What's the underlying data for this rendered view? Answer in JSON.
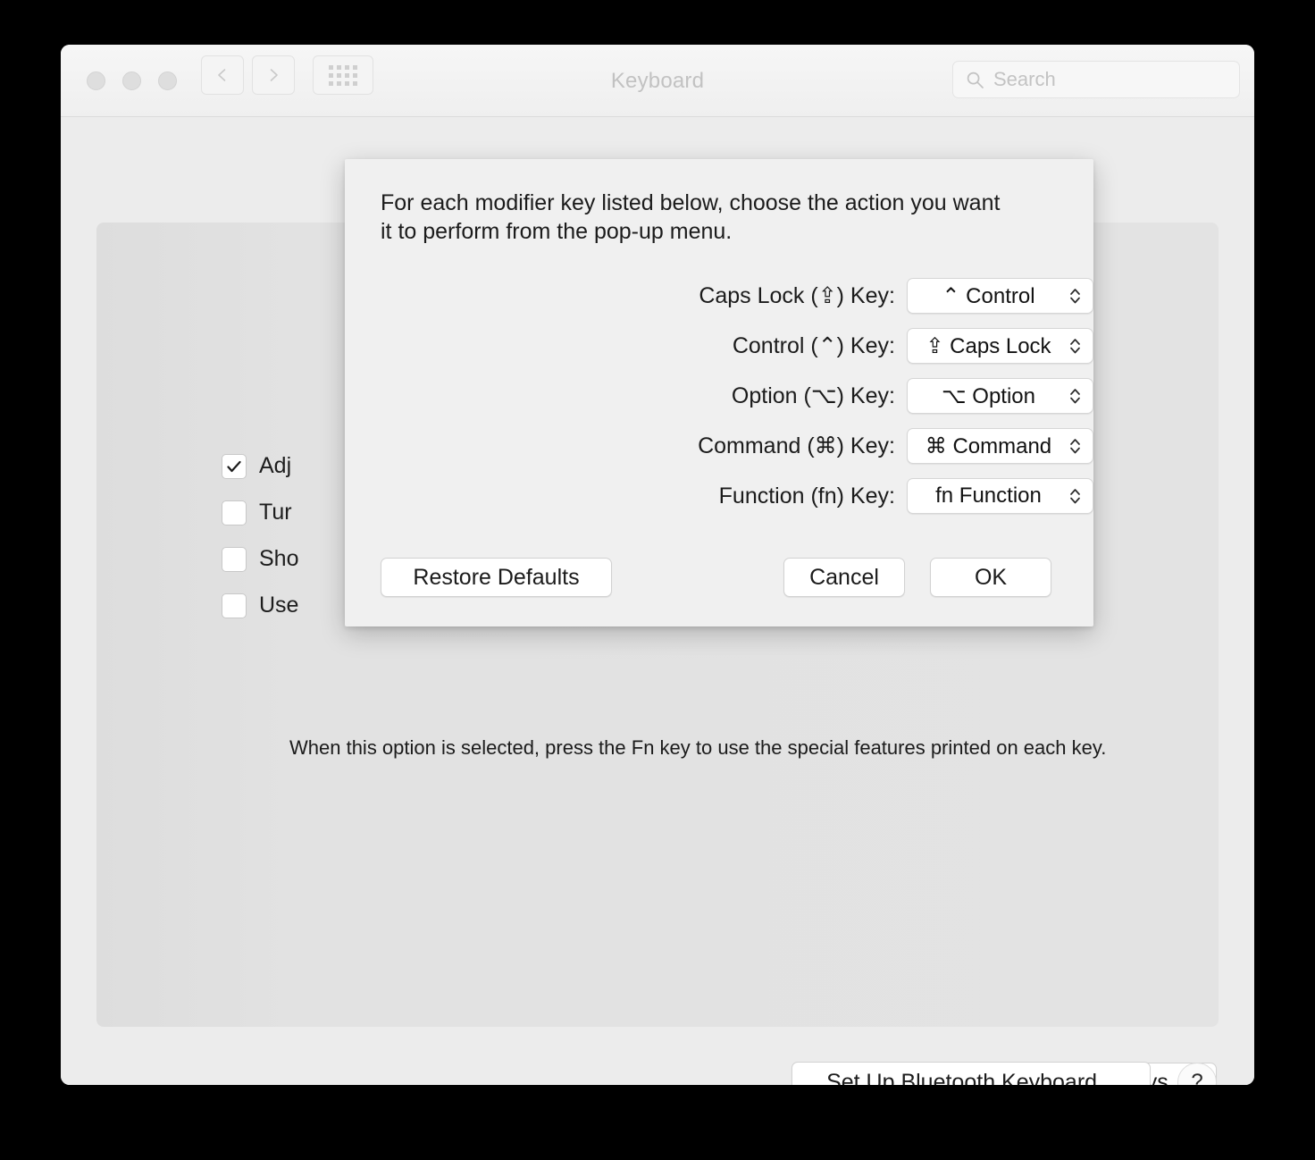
{
  "window": {
    "title": "Keyboard",
    "traffic_lights": [
      "close",
      "minimize",
      "zoom"
    ],
    "toolbar": {
      "back_icon": "chevron-left-icon",
      "forward_icon": "chevron-right-icon",
      "show_all_icon": "grid-icon"
    },
    "search": {
      "icon": "search-icon",
      "placeholder": "Search",
      "value": ""
    }
  },
  "main": {
    "checkboxes": [
      {
        "label": "Adj",
        "checked": true
      },
      {
        "label": "Tur",
        "checked": false
      },
      {
        "label": "Sho",
        "checked": false
      },
      {
        "label": "Use",
        "checked": false
      }
    ],
    "hint": "When this option is selected, press the Fn key to use the special features printed on each key.",
    "modifier_keys_button": "Modifier Keys...",
    "setup_bluetooth_button": "Set Up Bluetooth Keyboard...",
    "help_button": "?"
  },
  "sheet": {
    "description": "For each modifier key listed below, choose the action you want it to perform from the pop-up menu.",
    "rows": [
      {
        "label": "Caps Lock (⇪) Key:",
        "value": "⌃ Control",
        "name": "caps-lock-key"
      },
      {
        "label": "Control (⌃) Key:",
        "value": "⇪ Caps Lock",
        "name": "control-key"
      },
      {
        "label": "Option (⌥) Key:",
        "value": "⌥ Option",
        "name": "option-key"
      },
      {
        "label": "Command (⌘) Key:",
        "value": "⌘ Command",
        "name": "command-key"
      },
      {
        "label": "Function (fn) Key:",
        "value": "fn Function",
        "name": "function-key"
      }
    ],
    "buttons": {
      "restore_defaults": "Restore Defaults",
      "cancel": "Cancel",
      "ok": "OK"
    }
  },
  "colors": {
    "window_bg": "#ececec",
    "panel_bg": "#e2e2e2",
    "sheet_bg": "#f0f0f0",
    "title_text": "#c2c2c2",
    "body_text": "#1b1b1b",
    "control_white": "#ffffff"
  }
}
